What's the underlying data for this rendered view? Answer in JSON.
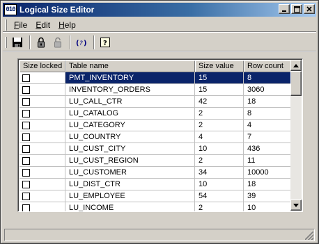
{
  "window": {
    "app_icon_text": "010",
    "title": "Logical Size Editor",
    "buttons": {
      "minimize": "_",
      "maximize": "□",
      "close": "×"
    }
  },
  "menu": {
    "items": [
      {
        "label": "File",
        "accel": "F",
        "rest": "ile"
      },
      {
        "label": "Edit",
        "accel": "E",
        "rest": "dit"
      },
      {
        "label": "Help",
        "accel": "H",
        "rest": "elp"
      }
    ]
  },
  "toolbar": {
    "buttons": [
      {
        "icon": "save-icon"
      },
      {
        "icon": "lock-icon"
      },
      {
        "icon": "unlock-icon"
      },
      {
        "icon": "refresh-icon"
      },
      {
        "icon": "help-icon"
      }
    ]
  },
  "grid": {
    "columns": [
      "Size locked",
      "Table name",
      "Size value",
      "Row count"
    ],
    "rows": [
      {
        "locked": false,
        "table": "PMT_INVENTORY",
        "size": "15",
        "count": "8",
        "selected": true
      },
      {
        "locked": false,
        "table": "INVENTORY_ORDERS",
        "size": "15",
        "count": "3060"
      },
      {
        "locked": false,
        "table": "LU_CALL_CTR",
        "size": "42",
        "count": "18"
      },
      {
        "locked": false,
        "table": "LU_CATALOG",
        "size": "2",
        "count": "8"
      },
      {
        "locked": false,
        "table": "LU_CATEGORY",
        "size": "2",
        "count": "4"
      },
      {
        "locked": false,
        "table": "LU_COUNTRY",
        "size": "4",
        "count": "7"
      },
      {
        "locked": false,
        "table": "LU_CUST_CITY",
        "size": "10",
        "count": "436"
      },
      {
        "locked": false,
        "table": "LU_CUST_REGION",
        "size": "2",
        "count": "11"
      },
      {
        "locked": false,
        "table": "LU_CUSTOMER",
        "size": "34",
        "count": "10000"
      },
      {
        "locked": false,
        "table": "LU_DIST_CTR",
        "size": "10",
        "count": "18"
      },
      {
        "locked": false,
        "table": "LU_EMPLOYEE",
        "size": "54",
        "count": "39"
      },
      {
        "locked": false,
        "table": "LU_INCOME",
        "size": "2",
        "count": "10"
      }
    ]
  },
  "scrollbar": {
    "up": "▲",
    "down": "▼",
    "position_fraction": 0.0
  },
  "statusbar": {
    "text": ""
  }
}
